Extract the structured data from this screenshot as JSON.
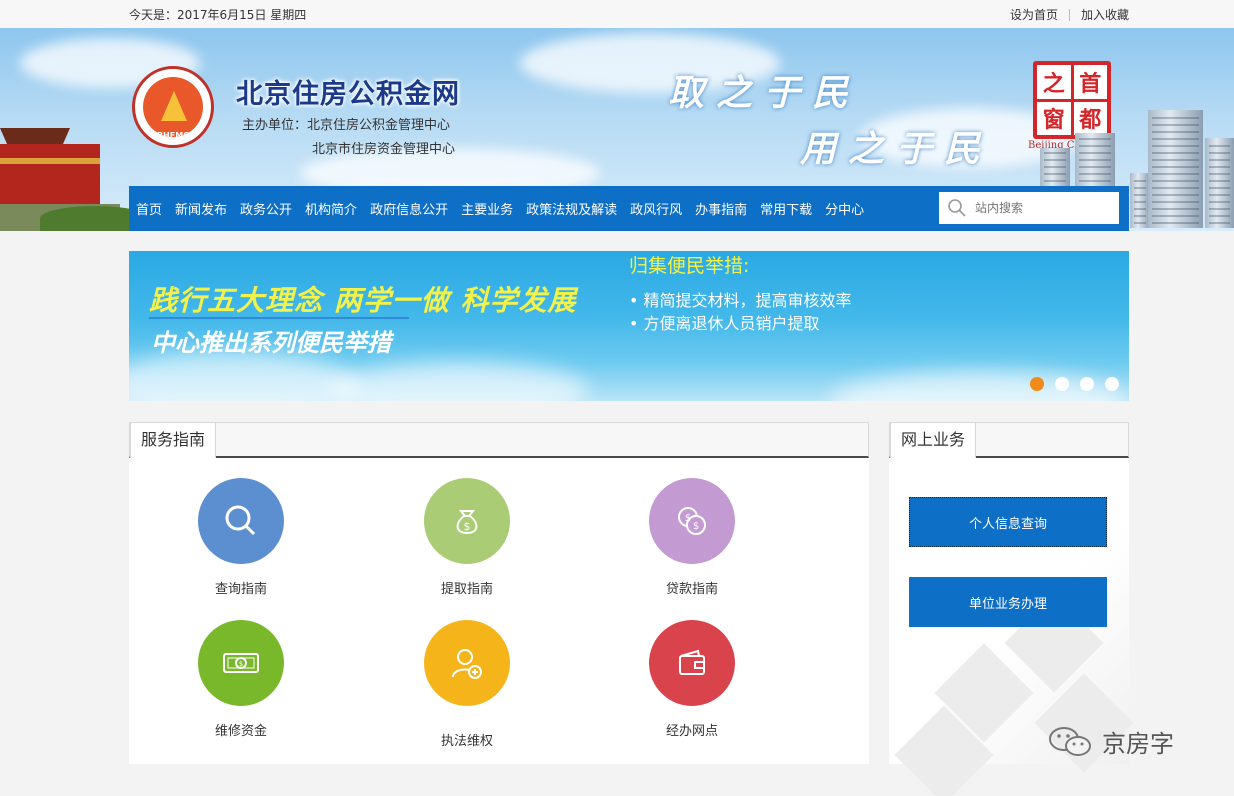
{
  "topbar": {
    "date_text": "今天是：2017年6月15日  星期四",
    "set_home": "设为首页",
    "add_favorite": "加入收藏"
  },
  "header": {
    "logo_code": "BHFMC",
    "site_title": "北京住房公积金网",
    "sponsor_line1": "主办单位：北京住房公积金管理中心",
    "sponsor_line2": "北京市住房资金管理中心",
    "slogan_line1": "取之于民",
    "slogan_line2": "用之于民",
    "seal_chars": [
      "首",
      "之",
      "都",
      "窗"
    ],
    "seal_caption": "Beijing China"
  },
  "nav": {
    "items": [
      "首页",
      "新闻发布",
      "政务公开",
      "机构简介",
      "政府信息公开",
      "主要业务",
      "政策法规及解读",
      "政风行风",
      "办事指南",
      "常用下载",
      "分中心"
    ],
    "search_placeholder": "站内搜索"
  },
  "banner": {
    "headline": "践行五大理念 两学一做 科学发展",
    "subheadline": "中心推出系列便民举措",
    "measures_title": "归集便民举措:",
    "measures": [
      "精简提交材料，提高审核效率",
      "方便离退休人员销户提取"
    ],
    "slide_count": 4,
    "active_slide": 1
  },
  "service_guide": {
    "title": "服务指南",
    "items": [
      {
        "label": "查询指南",
        "color": "#5b8fcf",
        "icon": "search-icon"
      },
      {
        "label": "提取指南",
        "color": "#a9cc74",
        "icon": "money-bag-icon"
      },
      {
        "label": "贷款指南",
        "color": "#c39ad1",
        "icon": "coins-icon"
      },
      {
        "label": "维修资金",
        "color": "#7ab82b",
        "icon": "banknote-icon"
      },
      {
        "label": "执法维权",
        "color": "#f5b41a",
        "icon": "user-add-icon"
      },
      {
        "label": "经办网点",
        "color": "#d9434b",
        "icon": "wallet-icon"
      }
    ]
  },
  "online_business": {
    "title": "网上业务",
    "buttons": [
      "个人信息查询",
      "单位业务办理"
    ]
  },
  "watermark": {
    "text": "京房字"
  }
}
